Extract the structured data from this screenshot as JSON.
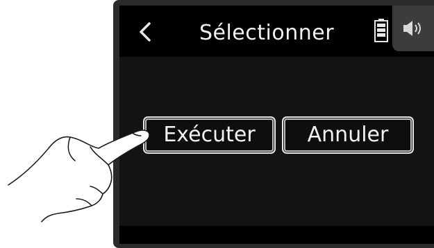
{
  "screen": {
    "title": "Sélectionner",
    "back_icon": "chevron-left-icon",
    "battery_icon": "battery-icon",
    "speaker_icon": "speaker-icon"
  },
  "dialog": {
    "execute_label": "Exécuter",
    "cancel_label": "Annuler"
  },
  "illustration": {
    "hand": "pointing-hand-icon"
  }
}
